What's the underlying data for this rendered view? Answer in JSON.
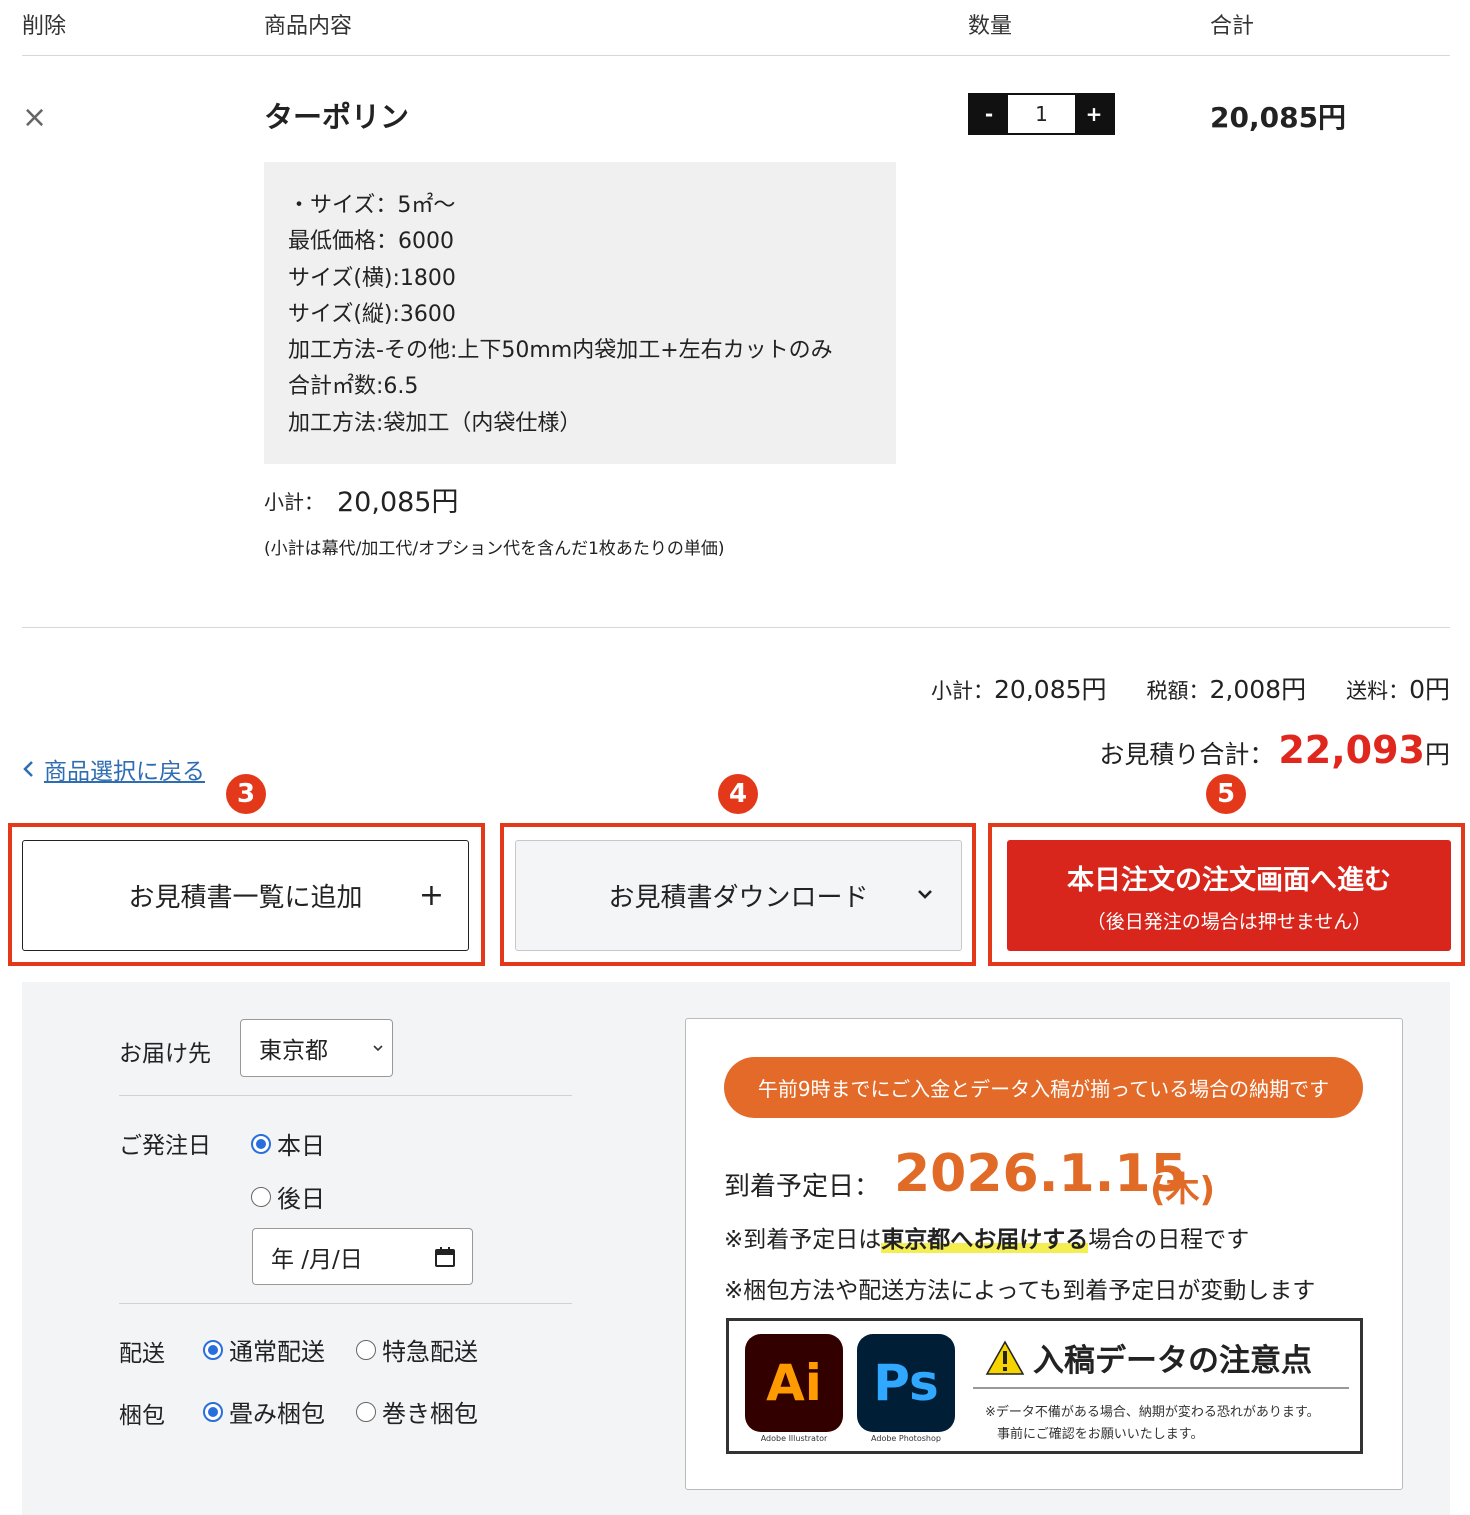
{
  "table_header": {
    "delete": "削除",
    "content": "商品内容",
    "quantity": "数量",
    "total": "合計"
  },
  "item": {
    "delete_symbol": "×",
    "name": "ターポリン",
    "qty_minus": "-",
    "qty_value": "1",
    "qty_plus": "+",
    "line_total": "20,085円",
    "specs": [
      "・サイズ：5㎡〜",
      "最低価格：6000",
      "サイズ(横):1800",
      "サイズ(縦):3600",
      "加工方法-その他:上下50mm内袋加工+左右カットのみ",
      "合計㎡数:6.5",
      "加工方法:袋加工（内袋仕様）"
    ],
    "subtotal_label": "小計：",
    "subtotal_value": "20,085円",
    "subtotal_note": "(小計は幕代/加工代/オプション代を含んだ1枚あたりの単価)"
  },
  "summary": {
    "subtotal_label": "小計：",
    "subtotal_value": "20,085円",
    "tax_label": "税額：",
    "tax_value": "2,008円",
    "shipping_label": "送料：",
    "shipping_value": "0円",
    "grand_label": "お見積り合計：",
    "grand_value": "22,093",
    "grand_unit": "円"
  },
  "back_link": {
    "icon": "chevron-left",
    "label": "商品選択に戻る"
  },
  "badges": [
    "3",
    "4",
    "5"
  ],
  "actions": {
    "add_quote": "お見積書一覧に追加",
    "add_quote_icon": "+",
    "download_quote": "お見積書ダウンロード",
    "order_line1": "本日注文の注文画面へ進む",
    "order_line2": "（後日発注の場合は押せません）"
  },
  "form": {
    "destination_label": "お届け先",
    "destination_value": "東京都",
    "order_date_label": "ご発注日",
    "order_date_options": [
      "本日",
      "後日"
    ],
    "order_date_selected": "本日",
    "date_placeholder": "年 /月/日",
    "shipping_label": "配送",
    "shipping_options": [
      "通常配送",
      "特急配送"
    ],
    "shipping_selected": "通常配送",
    "packing_label": "梱包",
    "packing_options": [
      "畳み梱包",
      "巻き梱包"
    ],
    "packing_selected": "畳み梱包"
  },
  "delivery": {
    "pill": "午前9時までにご入金とデータ入稿が揃っている場合の納期です",
    "arrival_label": "到着予定日：",
    "arrival_date": "2026.1.15",
    "arrival_day": "(木)",
    "note1_pre": "※到着予定日は",
    "note1_mark": "東京都へお届けする",
    "note1_post": "場合の日程です",
    "note2": "※梱包方法や配送方法によっても到着予定日が変動します"
  },
  "banner": {
    "ai_label": "Ai",
    "ai_caption": "Adobe Illustrator",
    "ps_label": "Ps",
    "ps_caption": "Adobe Photoshop",
    "title": "入稿データの注意点",
    "line1": "※データ不備がある場合、納期が変わる恐れがあります。",
    "line2": "事前にご確認をお願いいたします。"
  },
  "colors": {
    "accent_red": "#e3391a",
    "order_red": "#d9261c",
    "price_red": "#e0271d",
    "orange": "#e36a28",
    "link_blue": "#2f6db2",
    "radio_blue": "#2a6edb"
  }
}
